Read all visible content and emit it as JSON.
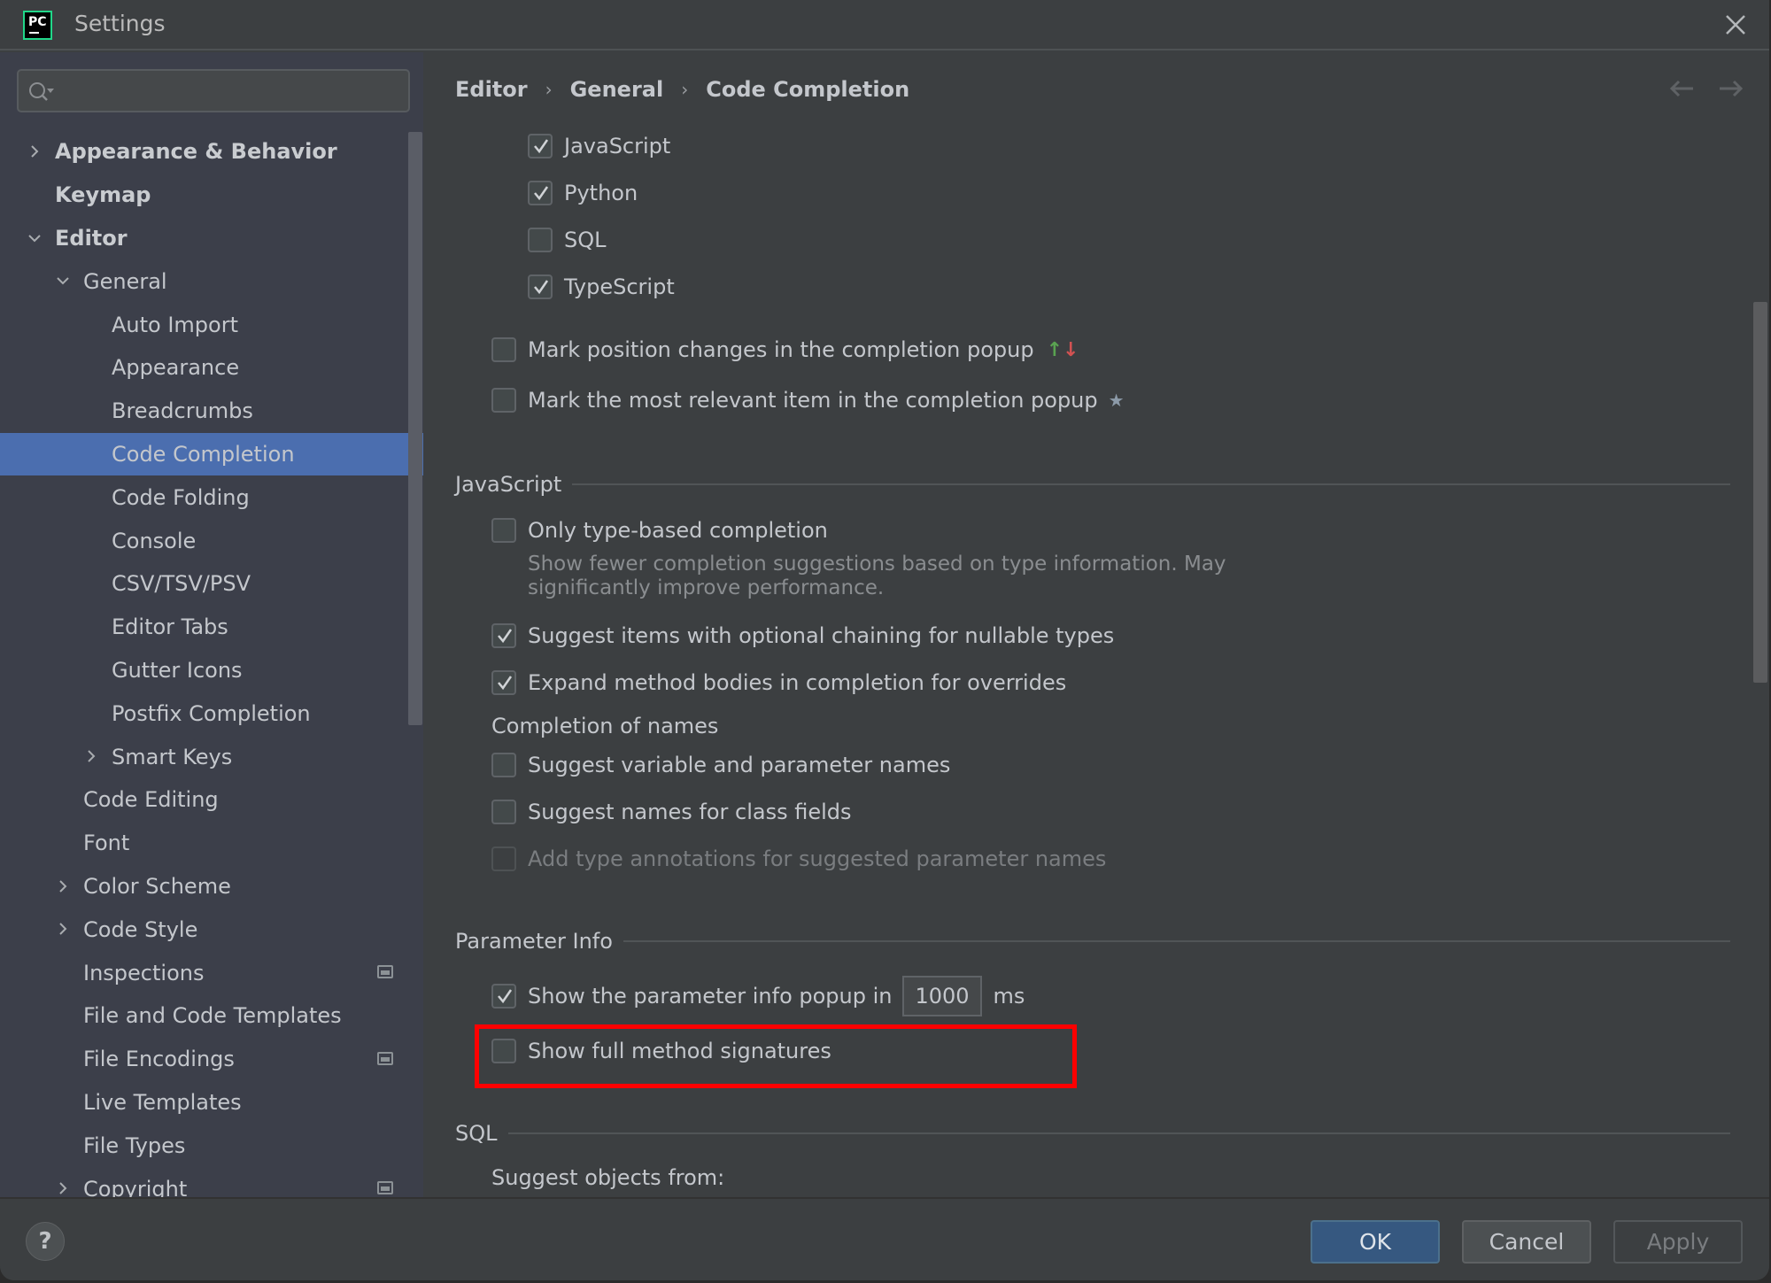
{
  "window": {
    "title": "Settings",
    "app_logo_text": "PC"
  },
  "search": {
    "placeholder": "",
    "value": ""
  },
  "sidebar": {
    "items": [
      {
        "label": "Appearance & Behavior",
        "level": 0,
        "expander": "collapsed",
        "bold": true
      },
      {
        "label": "Keymap",
        "level": 0,
        "expander": "none",
        "bold": true
      },
      {
        "label": "Editor",
        "level": 0,
        "expander": "expanded",
        "bold": true
      },
      {
        "label": "General",
        "level": 1,
        "expander": "expanded"
      },
      {
        "label": "Auto Import",
        "level": 2,
        "expander": "none"
      },
      {
        "label": "Appearance",
        "level": 2,
        "expander": "none"
      },
      {
        "label": "Breadcrumbs",
        "level": 2,
        "expander": "none"
      },
      {
        "label": "Code Completion",
        "level": 2,
        "expander": "none",
        "selected": true
      },
      {
        "label": "Code Folding",
        "level": 2,
        "expander": "none"
      },
      {
        "label": "Console",
        "level": 2,
        "expander": "none"
      },
      {
        "label": "CSV/TSV/PSV",
        "level": 2,
        "expander": "none"
      },
      {
        "label": "Editor Tabs",
        "level": 2,
        "expander": "none"
      },
      {
        "label": "Gutter Icons",
        "level": 2,
        "expander": "none"
      },
      {
        "label": "Postfix Completion",
        "level": 2,
        "expander": "none"
      },
      {
        "label": "Smart Keys",
        "level": 2,
        "expander": "collapsed"
      },
      {
        "label": "Code Editing",
        "level": 1,
        "expander": "none"
      },
      {
        "label": "Font",
        "level": 1,
        "expander": "none"
      },
      {
        "label": "Color Scheme",
        "level": 1,
        "expander": "collapsed"
      },
      {
        "label": "Code Style",
        "level": 1,
        "expander": "collapsed"
      },
      {
        "label": "Inspections",
        "level": 1,
        "expander": "none",
        "project_icon": true
      },
      {
        "label": "File and Code Templates",
        "level": 1,
        "expander": "none"
      },
      {
        "label": "File Encodings",
        "level": 1,
        "expander": "none",
        "project_icon": true
      },
      {
        "label": "Live Templates",
        "level": 1,
        "expander": "none"
      },
      {
        "label": "File Types",
        "level": 1,
        "expander": "none"
      },
      {
        "label": "Copyright",
        "level": 1,
        "expander": "collapsed",
        "project_icon": true
      }
    ]
  },
  "breadcrumb": [
    "Editor",
    "General",
    "Code Completion"
  ],
  "content": {
    "languages": [
      {
        "label": "JavaScript",
        "checked": true
      },
      {
        "label": "Python",
        "checked": true
      },
      {
        "label": "SQL",
        "checked": false
      },
      {
        "label": "TypeScript",
        "checked": true
      }
    ],
    "mark_position_changes": {
      "label": "Mark position changes in the completion popup",
      "checked": false
    },
    "mark_most_relevant": {
      "label": "Mark the most relevant item in the completion popup",
      "checked": false,
      "icon": "★"
    },
    "javascript_section": {
      "title": "JavaScript",
      "only_type_based": {
        "label": "Only type-based completion",
        "checked": false
      },
      "hint": "Show fewer completion suggestions based on type information. May significantly improve performance.",
      "optional_chaining": {
        "label": "Suggest items with optional chaining for nullable types",
        "checked": true
      },
      "expand_method_bodies": {
        "label": "Expand method bodies in completion for overrides",
        "checked": true
      },
      "completion_of_names": "Completion of names",
      "suggest_variable_names": {
        "label": "Suggest variable and parameter names",
        "checked": false
      },
      "suggest_class_fields": {
        "label": "Suggest names for class fields",
        "checked": false
      },
      "add_type_annotations": {
        "label": "Add type annotations for suggested parameter names",
        "checked": false,
        "disabled": true
      }
    },
    "parameter_info_section": {
      "title": "Parameter Info",
      "show_popup": {
        "label": "Show the parameter info popup in",
        "checked": true,
        "value": "1000",
        "unit": "ms"
      },
      "show_full_signatures": {
        "label": "Show full method signatures",
        "checked": false
      }
    },
    "sql_section": {
      "title": "SQL",
      "suggest_objects_from": "Suggest objects from:"
    }
  },
  "buttons": {
    "help": "?",
    "ok": "OK",
    "cancel": "Cancel",
    "apply": "Apply"
  },
  "colors": {
    "selection": "#4b6eaf",
    "highlight_box": "#ff0000",
    "ok_button": "#365880",
    "arrow_up": "#5aa351",
    "arrow_down": "#d25252"
  }
}
